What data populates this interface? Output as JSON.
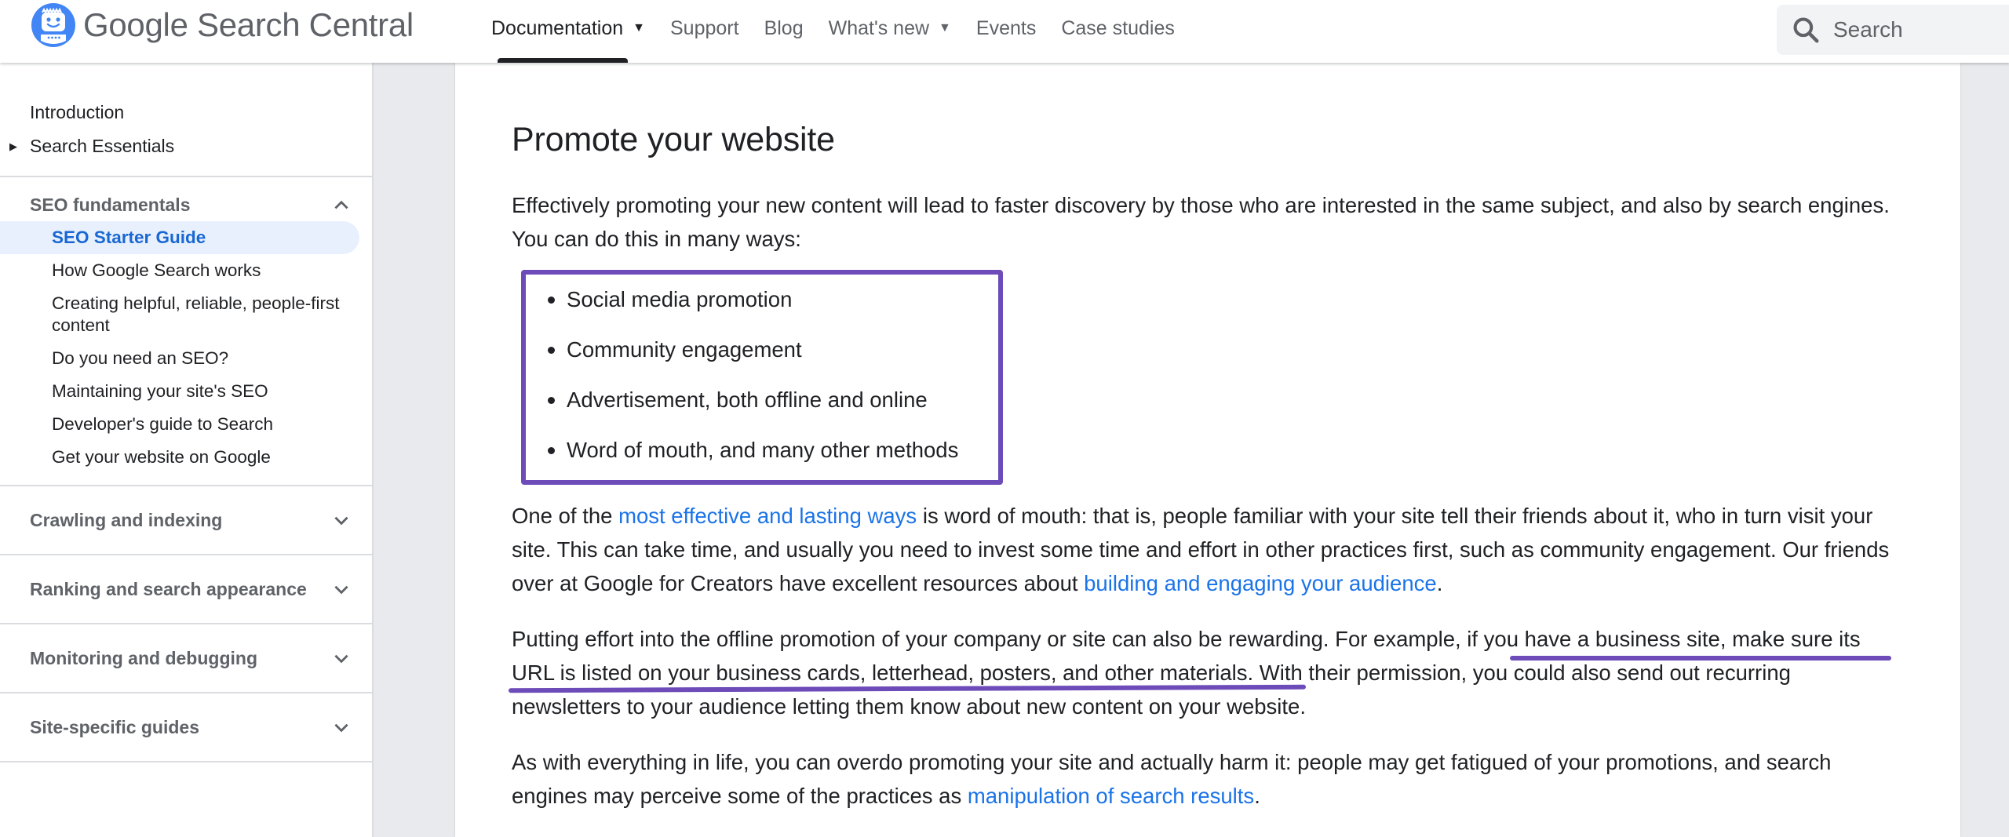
{
  "header": {
    "brand_google": "Google",
    "brand_product": "Search Central",
    "nav": [
      {
        "label": "Documentation",
        "has_dropdown": true,
        "active": true
      },
      {
        "label": "Support",
        "has_dropdown": false
      },
      {
        "label": "Blog",
        "has_dropdown": false
      },
      {
        "label": "What's new",
        "has_dropdown": true
      },
      {
        "label": "Events",
        "has_dropdown": false
      },
      {
        "label": "Case studies",
        "has_dropdown": false
      }
    ],
    "search_placeholder": "Search"
  },
  "sidebar": {
    "top_links": [
      {
        "label": "Introduction"
      },
      {
        "label": "Search Essentials",
        "expandable": true
      }
    ],
    "sections": [
      {
        "title": "SEO fundamentals",
        "expanded": true,
        "items": [
          {
            "label": "SEO Starter Guide",
            "selected": true
          },
          {
            "label": "How Google Search works"
          },
          {
            "label": "Creating helpful, reliable, people-first content"
          },
          {
            "label": "Do you need an SEO?"
          },
          {
            "label": "Maintaining your site's SEO"
          },
          {
            "label": "Developer's guide to Search"
          },
          {
            "label": "Get your website on Google"
          }
        ]
      },
      {
        "title": "Crawling and indexing",
        "expanded": false
      },
      {
        "title": "Ranking and search appearance",
        "expanded": false
      },
      {
        "title": "Monitoring and debugging",
        "expanded": false
      },
      {
        "title": "Site-specific guides",
        "expanded": false
      }
    ]
  },
  "article": {
    "heading": "Promote your website",
    "intro": "Effectively promoting your new content will lead to faster discovery by those who are interested in the same subject, and also by search engines. You can do this in many ways:",
    "bullets": [
      "Social media promotion",
      "Community engagement",
      "Advertisement, both offline and online",
      "Word of mouth, and many other methods"
    ],
    "p2": {
      "before": "One of the ",
      "link1": "most effective and lasting ways",
      "middle": " is word of mouth: that is, people familiar with your site tell their friends about it, who in turn visit your site. This can take time, and usually you need to invest some time and effort in other practices first, such as community engagement. Our friends over at Google for Creators have excellent resources about ",
      "link2": "building and engaging your audience",
      "after": "."
    },
    "p3": {
      "before": "Putting effort into the offline promotion of your company or site can also be rewarding. For example, ",
      "highlight": "if you have a business site, make sure its URL is listed on your business cards, letterhead, posters, and other materials.",
      "after": " With their permission, you could also send out recurring newsletters to your audience letting them know about new content on your website."
    },
    "p4": {
      "before": "As with everything in life, you can overdo promoting your site and actually harm it: people may get fatigued of your promotions, and search engines may perceive some of the practices as ",
      "link": "manipulation of search results",
      "after": "."
    }
  },
  "annotations": {
    "color": "#6d4cb9"
  }
}
